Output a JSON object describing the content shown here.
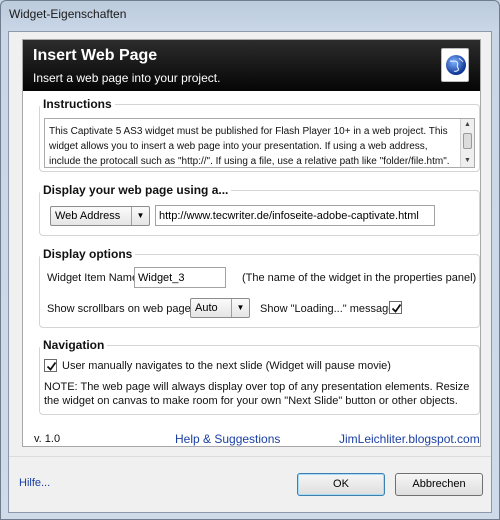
{
  "window": {
    "title": "Widget-Eigenschaften"
  },
  "header": {
    "title": "Insert Web Page",
    "subtitle": "Insert a web page into your project."
  },
  "instructions": {
    "label": "Instructions",
    "text": "This Captivate 5 AS3 widget must be published for Flash Player 10+ in a web project.  This widget allows you to insert a web page into your presentation.  If using a web address, include the protocall such as \"http://\".   If using a file, use a relative path like \"folder/file.htm\"."
  },
  "display": {
    "label": "Display your web page using a...",
    "source_type": "Web Address",
    "url": "http://www.tecwriter.de/infoseite-adobe-captivate.html"
  },
  "options": {
    "label": "Display options",
    "widget_name_label": "Widget Item Name",
    "widget_name_value": "Widget_3",
    "widget_name_hint": "(The name of the widget in the properties panel)",
    "scrollbars_label": "Show scrollbars on web page",
    "scrollbars_value": "Auto",
    "loading_label": "Show \"Loading...\" message",
    "loading_checked": true
  },
  "navigation": {
    "label": "Navigation",
    "manual_label": "User manually navigates to the next slide (Widget will pause movie)",
    "manual_checked": true,
    "note": "NOTE:  The web page will always display over top of any presentation elements.  Resize the widget on canvas to make room for your own \"Next Slide\" button or other objects."
  },
  "panel_footer": {
    "version": "v. 1.0",
    "help_link": "Help & Suggestions",
    "blog_link": "JimLeichliter.blogspot.com"
  },
  "dialog_footer": {
    "help": "Hilfe...",
    "ok": "OK",
    "cancel": "Abbrechen"
  },
  "icons": {
    "header_icon": "globe-page-icon",
    "dropdown": "chevron-down-icon",
    "check": "checkmark-icon"
  }
}
